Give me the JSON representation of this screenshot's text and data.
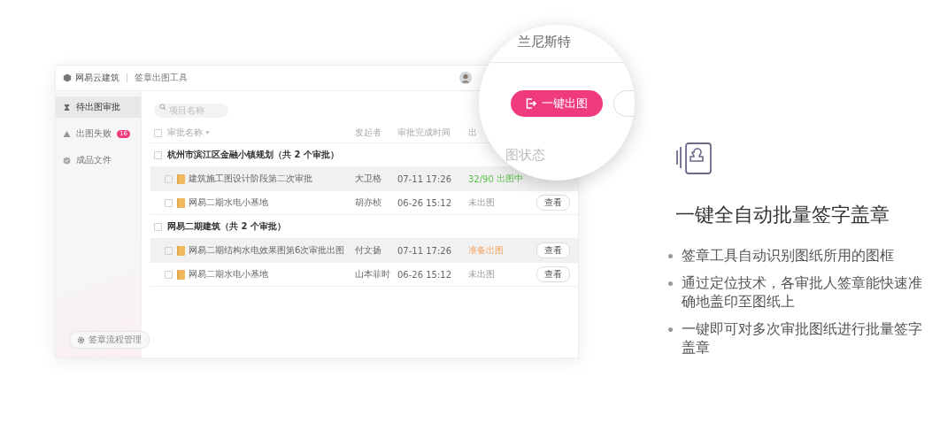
{
  "app": {
    "header": {
      "brand": "网易云建筑",
      "tool": "签章出图工具"
    },
    "sidebar": {
      "items": [
        {
          "label": "待出图审批",
          "kind": "pending",
          "selected": true
        },
        {
          "label": "出图失败",
          "kind": "failed",
          "selected": false,
          "badge": "16"
        },
        {
          "label": "成品文件",
          "kind": "done",
          "selected": false
        }
      ],
      "footer_button": "签章流程管理"
    },
    "search": {
      "placeholder": "项目名称"
    },
    "table": {
      "header_checked": false,
      "columns": [
        {
          "label": "审批名称",
          "sortable": true
        },
        {
          "label": "发起者"
        },
        {
          "label": "审批完成时间"
        },
        {
          "label": "出"
        }
      ],
      "groups": [
        {
          "title": "杭州市滨江区金融小镇规划（共 2 个审批）",
          "checked": false,
          "rows": [
            {
              "name": "建筑施工图设计阶段第二次审批",
              "sender": "大卫格",
              "time": "07-11 17:26",
              "status": {
                "kind": "progress",
                "progress": "32/90",
                "text": "出图中"
              },
              "highlighted": true,
              "checked": false
            },
            {
              "name": "网易二期水电小基地",
              "sender": "胡亦桢",
              "time": "06-26 15:12",
              "status": {
                "kind": "none",
                "text": "未出图"
              },
              "action": "查看",
              "highlighted": false,
              "checked": false
            }
          ]
        },
        {
          "title": "网易二期建筑（共 2 个审批）",
          "checked": false,
          "rows": [
            {
              "name": "网易二期结构水电效果图第6次审批出图",
              "sender": "付文扬",
              "time": "07-11 17:26",
              "status": {
                "kind": "ready",
                "text": "准备出图"
              },
              "action": "查看",
              "highlighted": true,
              "checked": false
            },
            {
              "name": "网易二期水电小基地",
              "sender": "山本菲时",
              "time": "06-26 15:12",
              "status": {
                "kind": "none",
                "text": "未出图"
              },
              "action": "查看",
              "highlighted": false,
              "checked": false
            }
          ]
        }
      ]
    }
  },
  "magnifier": {
    "user_name": "兰尼斯特",
    "button": "一键出图",
    "heading": "图状态"
  },
  "feature": {
    "title": "一键全自动批量签字盖章",
    "bullets": [
      "签章工具自动识别图纸所用的图框",
      "通过定位技术，各审批人签章能快速准确地盖印至图纸上",
      "一键即可对多次审批图纸进行批量签字盖章"
    ]
  }
}
